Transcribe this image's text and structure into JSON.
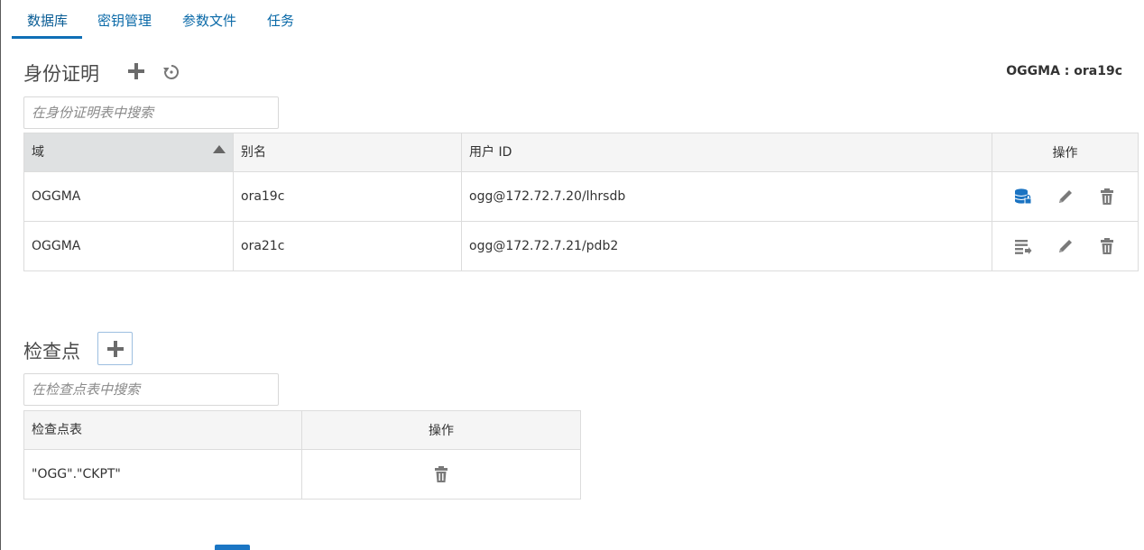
{
  "tabs": [
    {
      "label": "数据库",
      "active": true
    },
    {
      "label": "密钥管理",
      "active": false
    },
    {
      "label": "参数文件",
      "active": false
    },
    {
      "label": "任务",
      "active": false
    }
  ],
  "credentials": {
    "title": "身份证明",
    "connection_label": "OGGMA : ora19c",
    "search_placeholder": "在身份证明表中搜索",
    "columns": [
      "域",
      "别名",
      "用户 ID",
      "操作"
    ],
    "sorted_column": "域",
    "rows": [
      {
        "domain": "OGGMA",
        "alias": "ora19c",
        "user_id": "ogg@172.72.7.20/lhrsdb",
        "connected": true
      },
      {
        "domain": "OGGMA",
        "alias": "ora21c",
        "user_id": "ogg@172.72.7.21/pdb2",
        "connected": false
      }
    ]
  },
  "checkpoints": {
    "title": "检查点",
    "search_placeholder": "在检查点表中搜索",
    "columns": [
      "检查点表",
      "操作"
    ],
    "rows": [
      {
        "table": "\"OGG\".\"CKPT\""
      }
    ]
  },
  "colors": {
    "accent": "#0f6fb6",
    "icon_gray": "#7a7a7a",
    "icon_blue": "#1a73c2"
  }
}
